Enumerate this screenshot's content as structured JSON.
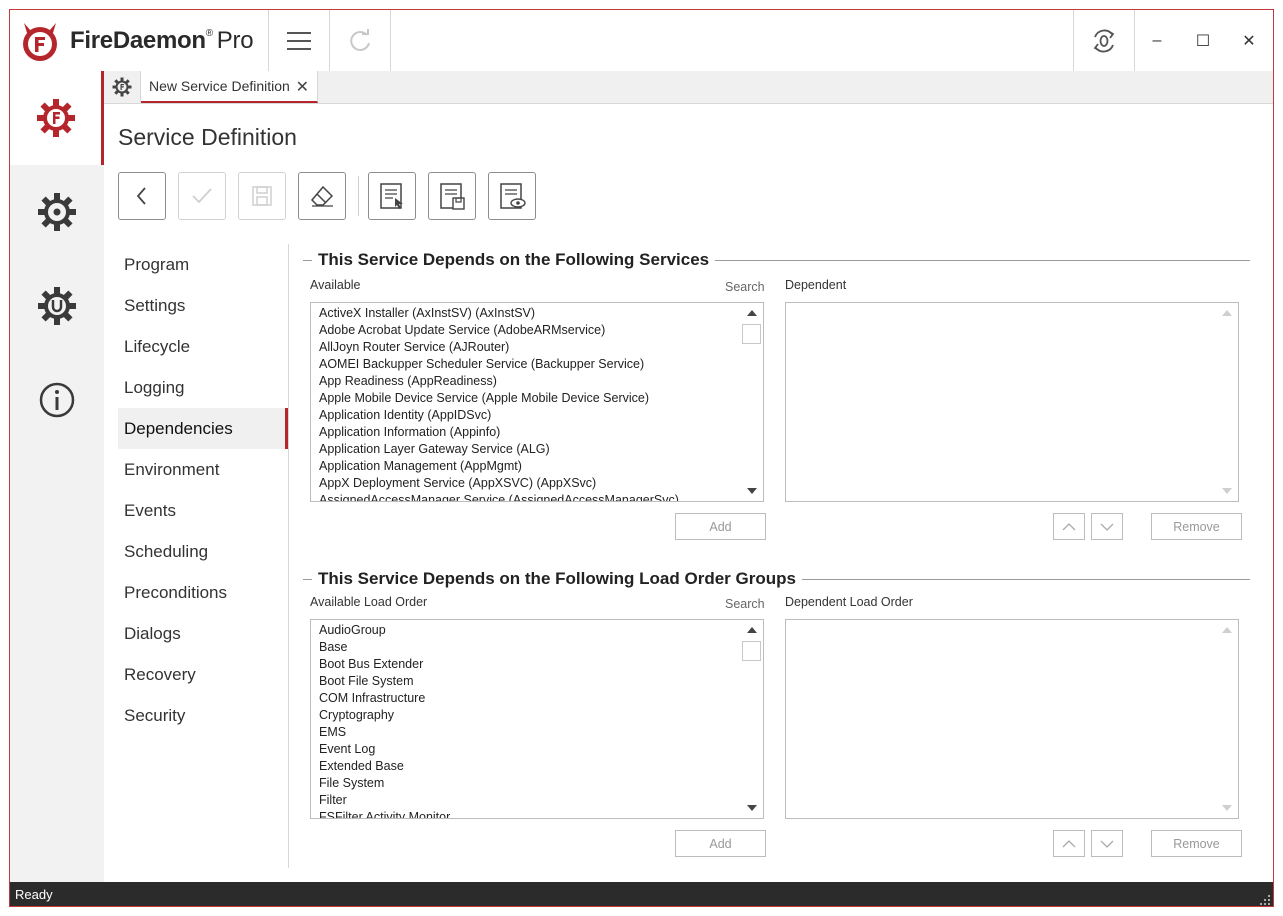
{
  "app": {
    "brand": "FireDaemon",
    "brand_mark": "®",
    "edition": "Pro"
  },
  "titlebar": {
    "menu_icon": "hamburger-icon",
    "refresh_icon": "refresh-icon",
    "sync_icon": "sync-icon",
    "minimize": "–",
    "maximize": "☐",
    "close": "✕"
  },
  "rail": {
    "items": [
      "service-gear-icon",
      "settings-gear-icon",
      "update-gear-icon",
      "info-icon"
    ]
  },
  "tabs": {
    "home_icon": "service-gear-icon",
    "active_tab": "New Service Definition",
    "close": "✕"
  },
  "page": {
    "title": "Service Definition"
  },
  "toolbar": {
    "buttons": [
      "back-icon",
      "check-icon",
      "save-icon",
      "eraser-icon",
      "doc-select-icon",
      "doc-save-icon",
      "doc-view-icon"
    ]
  },
  "nav": {
    "items": [
      "Program",
      "Settings",
      "Lifecycle",
      "Logging",
      "Dependencies",
      "Environment",
      "Events",
      "Scheduling",
      "Preconditions",
      "Dialogs",
      "Recovery",
      "Security"
    ],
    "active": "Dependencies"
  },
  "services": {
    "title": "This Service Depends on the Following Services",
    "available_label": "Available",
    "search_label": "Search",
    "dependent_label": "Dependent",
    "available": [
      "ActiveX Installer (AxInstSV) (AxInstSV)",
      "Adobe Acrobat Update Service (AdobeARMservice)",
      "AllJoyn Router Service (AJRouter)",
      "AOMEI Backupper Scheduler Service (Backupper Service)",
      "App Readiness (AppReadiness)",
      "Apple Mobile Device Service (Apple Mobile Device Service)",
      "Application Identity (AppIDSvc)",
      "Application Information (Appinfo)",
      "Application Layer Gateway Service (ALG)",
      "Application Management (AppMgmt)",
      "AppX Deployment Service (AppXSVC) (AppXSvc)",
      "AssignedAccessManager Service (AssignedAccessManagerSvc)"
    ],
    "add_label": "Add",
    "remove_label": "Remove"
  },
  "groups": {
    "title": "This Service Depends on the Following Load Order Groups",
    "available_label": "Available Load Order",
    "search_label": "Search",
    "dependent_label": "Dependent Load Order",
    "available": [
      "AudioGroup",
      "Base",
      "Boot Bus Extender",
      "Boot File System",
      "COM Infrastructure",
      "Cryptography",
      "EMS",
      "Event Log",
      "Extended Base",
      "File System",
      "Filter",
      "FSFilter Activity Monitor"
    ],
    "add_label": "Add",
    "remove_label": "Remove"
  },
  "status": {
    "text": "Ready"
  },
  "colors": {
    "accent": "#b5262c",
    "statusbar": "#2b2b2b",
    "rail": "#f2f2f2"
  }
}
